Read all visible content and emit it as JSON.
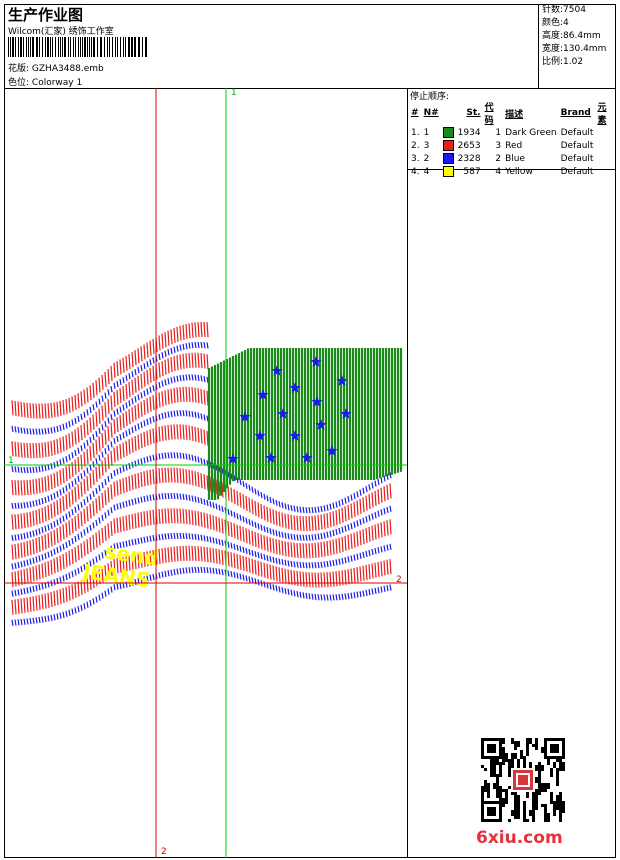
{
  "header": {
    "title": "生产作业图",
    "company": "Wilcom(汇家) 绣饰工作室",
    "pattern_label": "花版:",
    "pattern_value": "GZHA3488.emb",
    "colorway_label": "色位:",
    "colorway_value": "Colorway 1"
  },
  "stats": [
    {
      "label": "针数:",
      "value": "7504"
    },
    {
      "label": "颜色:",
      "value": "4"
    },
    {
      "label": "高度:",
      "value": "86.4mm"
    },
    {
      "label": "宽度:",
      "value": "130.4mm"
    },
    {
      "label": "比例:",
      "value": "1.02"
    }
  ],
  "sequence": {
    "title": "停止顺序:",
    "headers": [
      "#",
      "N#",
      "St.",
      "代码",
      "描述",
      "Brand",
      "元素"
    ],
    "rows": [
      {
        "num": "1.",
        "n": "1",
        "st": "1934",
        "code": "1",
        "desc": "Dark Green",
        "brand": "Default",
        "color": "#1a8a1a"
      },
      {
        "num": "2.",
        "n": "3",
        "st": "2653",
        "code": "3",
        "desc": "Red",
        "brand": "Default",
        "color": "#ee1c1c"
      },
      {
        "num": "3.",
        "n": "2",
        "st": "2328",
        "code": "2",
        "desc": "Blue",
        "brand": "Default",
        "color": "#1a1aee"
      },
      {
        "num": "4.",
        "n": "4",
        "st": "587",
        "code": "4",
        "desc": "Yellow",
        "brand": "Default",
        "color": "#ffff00"
      }
    ]
  },
  "design_text": {
    "line1": "send",
    "line2": "JEANS"
  },
  "markers": {
    "top": "1",
    "left": "1",
    "right": "2",
    "bottom": "2"
  },
  "watermark": "6xiu.com",
  "colors": {
    "green": "#1a8a1a",
    "red": "#ee1c1c",
    "blue": "#1a1aee",
    "yellow": "#ffff00",
    "guide_green": "#00cc00",
    "guide_red": "#dd0000"
  }
}
